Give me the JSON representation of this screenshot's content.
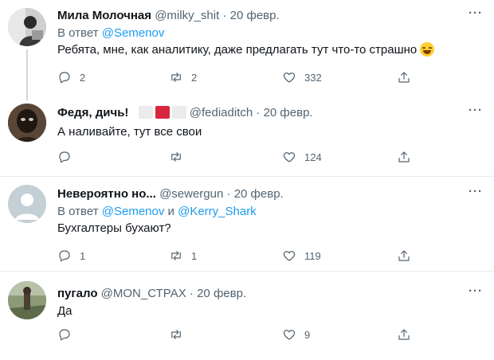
{
  "tweets": [
    {
      "name": "Мила Молочная",
      "handle": "@milky_shit",
      "separator": "·",
      "date": "20 февр.",
      "reply_prefix": "В ответ",
      "reply_mention": "@Semenov",
      "text": "Ребята, мне, как аналитику, даже предлагать тут что-то страшно",
      "emoji": "face-with-tears-of-joy",
      "replies": "2",
      "retweets": "2",
      "likes": "332"
    },
    {
      "name": "Федя, дичь!",
      "handle": "@fediaditch",
      "separator": "·",
      "date": "20 февр.",
      "text": "А наливайте, тут все свои",
      "badge_colors": [
        "#ebebeb",
        "#d7263d",
        "#ebebeb"
      ],
      "replies": "",
      "retweets": "",
      "likes": "124"
    },
    {
      "name": "Невероятно но...",
      "handle": "@sewergun",
      "separator": "·",
      "date": "20 февр.",
      "reply_prefix": "В ответ",
      "reply_mention": "@Semenov",
      "reply_and": "и",
      "reply_mention2": "@Kerry_Shark",
      "text": "Бухгалтеры бухают?",
      "replies": "1",
      "retweets": "1",
      "likes": "119"
    },
    {
      "name": "пугало",
      "handle": "@MON_СТРАХ",
      "separator": "·",
      "date": "20 февр.",
      "text": "Да",
      "replies": "",
      "retweets": "",
      "likes": "9"
    }
  ],
  "icons": {
    "more": "ellipsis-icon",
    "reply": "reply-icon",
    "retweet": "retweet-icon",
    "like": "heart-icon",
    "share": "share-icon"
  },
  "more_glyph": "···",
  "colors": {
    "text": "#0f1419",
    "secondary": "#536471",
    "link": "#1d9bf0",
    "divider": "#e6ecf0",
    "thread_line": "#cfd9de"
  }
}
